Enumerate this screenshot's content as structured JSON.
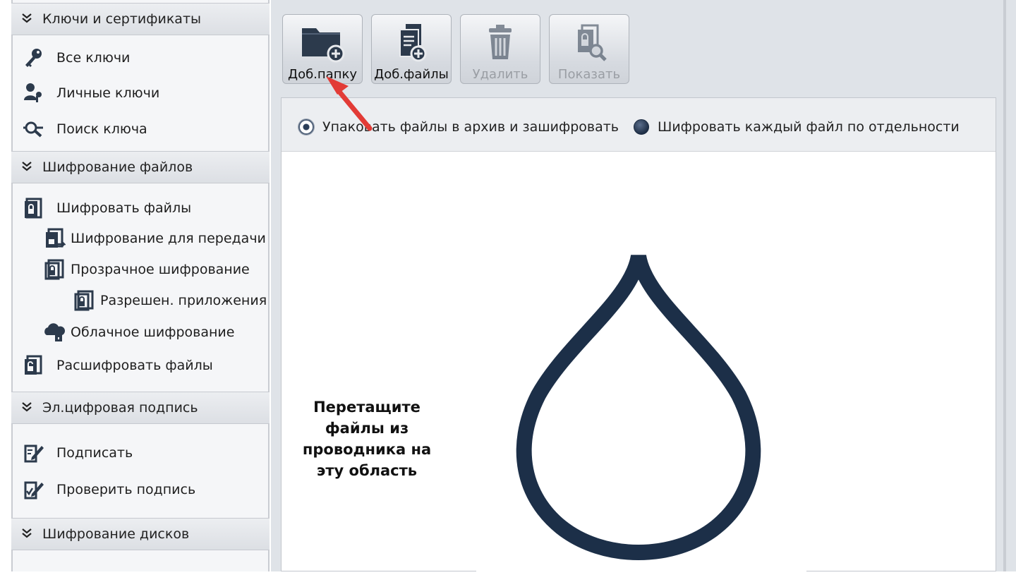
{
  "sidebar": {
    "sections": [
      {
        "title": "Ключи и сертификаты"
      },
      {
        "title": "Шифрование файлов"
      },
      {
        "title": "Эл.цифровая подпись"
      },
      {
        "title": "Шифрование дисков"
      }
    ],
    "keys": [
      "Все ключи",
      "Личные ключи",
      "Поиск ключа"
    ],
    "files": [
      "Шифровать файлы",
      "Шифрование для передачи",
      "Прозрачное шифрование",
      "Разрешен. приложения",
      "Облачное шифрование",
      "Расшифровать файлы"
    ],
    "signature": [
      "Подписать",
      "Проверить подпись"
    ]
  },
  "toolbar": {
    "add_folder": "Доб.папку",
    "add_files": "Доб.файлы",
    "delete": "Удалить",
    "show": "Показать"
  },
  "options": {
    "pack_archive": "Упаковать файлы в архив и зашифровать",
    "each_file": "Шифровать каждый файл по отдельности",
    "selected": "pack_archive"
  },
  "drop_zone": {
    "lines": [
      "Перетащите",
      "файлы из",
      "проводника на",
      "эту область"
    ]
  },
  "colors": {
    "drop_outline": "#1c2f48",
    "icon_dark": "#2c3a4c",
    "annotation_arrow": "#e23b36"
  },
  "icons": {
    "keys": [
      "key-icon",
      "personal-key-icon",
      "key-search-icon"
    ],
    "files": [
      "lock-file-icon",
      "transfer-lock-icon",
      "transparent-lock-icon",
      "app-lock-icon",
      "cloud-lock-icon",
      "decrypt-file-icon"
    ],
    "signature": [
      "sign-pen-icon",
      "verify-sign-icon"
    ],
    "toolbar": [
      "folder-add-icon",
      "files-add-icon",
      "trash-icon",
      "lock-search-icon"
    ]
  }
}
